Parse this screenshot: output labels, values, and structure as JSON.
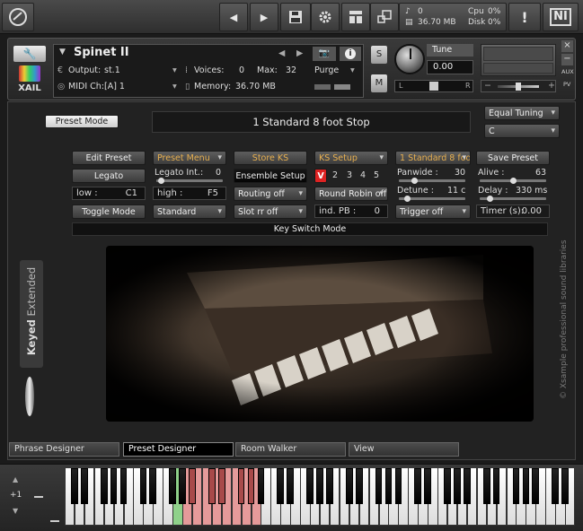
{
  "topbar": {
    "nav_prev": "◀",
    "nav_next": "▶",
    "stats": {
      "voices": "0",
      "memory": "36.70 MB",
      "cpu_label": "Cpu",
      "cpu_value": "0%",
      "disk_label": "Disk",
      "disk_value": "0%"
    },
    "warning": "!",
    "logo": "NI"
  },
  "instrument": {
    "name": "Spinet II",
    "output_label": "Output:",
    "output_value": "st.1",
    "voices_label": "Voices:",
    "voices_value": "0",
    "max_label": "Max:",
    "max_value": "32",
    "purge_label": "Purge",
    "midi_label": "MIDI Ch:",
    "midi_value": "[A]  1",
    "memory_label": "Memory:",
    "memory_value": "36.70 MB",
    "s_label": "S",
    "m_label": "M",
    "tune_label": "Tune",
    "tune_value": "0.00",
    "pan_left": "L",
    "pan_right": "R",
    "aux_label": "AUX",
    "pv_label": "PV",
    "brand": "XAIL"
  },
  "preset_panel": {
    "mode_button": "Preset Mode",
    "preset_display": "1 Standard 8 foot Stop",
    "tuning_select": "Equal Tuning",
    "key_select": "C"
  },
  "row1": {
    "edit_preset": "Edit Preset",
    "preset_menu": "Preset Menu",
    "store_ks": "Store KS",
    "ks_setup": "KS Setup",
    "preset_name_select": "1 Standard 8 foot S",
    "save_preset": "Save Preset"
  },
  "row2": {
    "legato": "Legato",
    "legato_int_label": "Legato Int.:",
    "legato_int_value": "0",
    "ensemble_setup": "Ensemble Setup",
    "ks_v": "V",
    "ks_2": "2",
    "ks_3": "3",
    "ks_4": "4",
    "ks_5": "5",
    "panwide_label": "Panwide :",
    "panwide_value": "30",
    "alive_label": "Alive :",
    "alive_value": "63"
  },
  "row3": {
    "low_label": "low :",
    "low_value": "C1",
    "high_label": "high :",
    "high_value": "F5",
    "routing": "Routing off",
    "round_robin": "Round Robin off",
    "detune_label": "Detune :",
    "detune_value": "11 c",
    "delay_label": "Delay :",
    "delay_value": "330 ms"
  },
  "row4": {
    "toggle_mode": "Toggle Mode",
    "standard": "Standard",
    "slot_rr": "Slot rr off",
    "ind_pb_label": "ind. PB :",
    "ind_pb_value": "0",
    "trigger": "Trigger off",
    "timer_label": "Timer (s):",
    "timer_value": "0.00"
  },
  "ks_mode_bar": "Key Switch Mode",
  "side_text": {
    "keyed": "Keyed",
    "extended": "Extended",
    "copyright": "© Xsample professional sound libraries"
  },
  "tabs": [
    "Phrase Designer",
    "Preset Designer",
    "Room Walker",
    "View"
  ],
  "keyboard": {
    "octave": "+1"
  }
}
